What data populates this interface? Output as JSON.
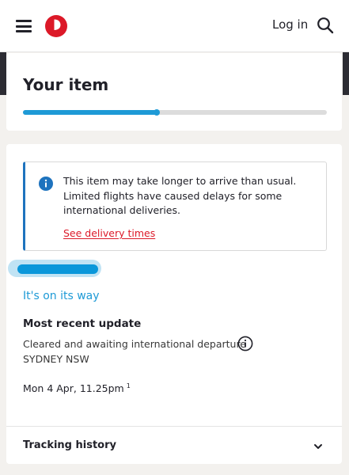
{
  "header": {
    "login_label": "Log in",
    "logo": "auspost-logo",
    "menu_icon": "hamburger-icon",
    "search_icon": "search-icon",
    "brand_color": "#dc1928"
  },
  "item": {
    "title": "Your item",
    "progress_fraction": 0.44
  },
  "alert": {
    "message": "This item may take longer to arrive than usual. Limited flights have caused delays for some international deliveries.",
    "link_label": "See delivery times"
  },
  "tracking": {
    "status": "It's on its way",
    "recent_update_title": "Most recent update",
    "event_description": "Cleared and awaiting international departure",
    "event_location": "SYDNEY NSW",
    "event_time": "Mon 4 Apr, 11.25pm",
    "event_time_note": "1",
    "history_label": "Tracking history"
  },
  "colors": {
    "accent": "#1e9ad6",
    "alert_border": "#1e73be",
    "link": "#dc1928"
  }
}
